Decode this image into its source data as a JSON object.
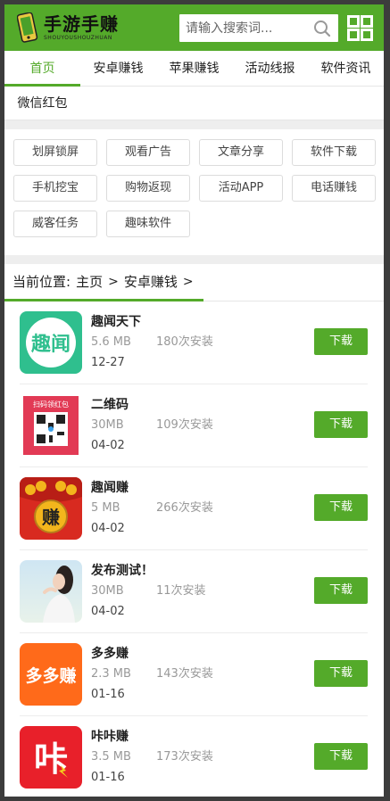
{
  "header": {
    "logo_text": "手游手赚",
    "logo_subtext": "SHOUYOUSHOUZHUAN",
    "search_placeholder": "请输入搜索词..."
  },
  "nav": {
    "row1": [
      "首页",
      "安卓赚钱",
      "苹果赚钱",
      "活动线报",
      "软件资讯"
    ],
    "row2": [
      "微信红包"
    ],
    "active": "首页"
  },
  "tags": [
    "划屏锁屏",
    "观看广告",
    "文章分享",
    "软件下载",
    "手机挖宝",
    "购物返现",
    "活动APP",
    "电话赚钱",
    "威客任务",
    "趣味软件"
  ],
  "breadcrumb": {
    "label": "当前位置:",
    "home": "主页",
    "current": "安卓赚钱",
    "sep": ">"
  },
  "download_label": "下载",
  "apps": [
    {
      "name": "趣闻天下",
      "size": "5.6 MB",
      "installs": "180次安装",
      "date": "12-27",
      "icon": "quwen-logo-icon"
    },
    {
      "name": "二维码",
      "size": "30MB",
      "installs": "109次安装",
      "date": "04-02",
      "icon": "qr-code-icon",
      "icon_caption": "扫码领红包"
    },
    {
      "name": "趣闻赚",
      "size": "5 MB",
      "installs": "266次安装",
      "date": "04-02",
      "icon": "zhuan-coin-icon",
      "icon_char": "赚"
    },
    {
      "name": "发布测试！",
      "size": "30MB",
      "installs": "11次安装",
      "date": "04-02",
      "icon": "portrait-photo-icon"
    },
    {
      "name": "多多赚",
      "size": "2.3 MB",
      "installs": "143次安装",
      "date": "01-16",
      "icon": "duoduozhuan-logo-icon",
      "icon_text": "多多赚"
    },
    {
      "name": "咔咔赚",
      "size": "3.5 MB",
      "installs": "173次安装",
      "date": "01-16",
      "icon": "kakazhuan-logo-icon",
      "icon_char": "咔"
    }
  ],
  "colors": {
    "brand_green": "#54aa2a",
    "quwen_teal": "#2fbf8e",
    "duoduo_orange": "#ff6a1a",
    "kaka_red": "#e8202a"
  }
}
